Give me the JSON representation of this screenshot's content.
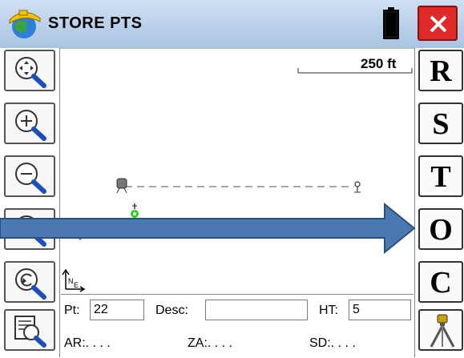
{
  "header": {
    "title": "STORE PTS"
  },
  "map": {
    "scale_label": "250 ft"
  },
  "right_toolbar": {
    "buttons": [
      "R",
      "S",
      "T",
      "O",
      "C"
    ]
  },
  "form": {
    "pt_label": "Pt:",
    "pt_value": "22",
    "desc_label": "Desc:",
    "desc_value": "",
    "ht_label": "HT:",
    "ht_value": "5",
    "ar_label": "AR:. . . .",
    "za_label": "ZA:. . . .",
    "sd_label": "SD:. . . ."
  },
  "colors": {
    "titlebar": "#b9d0ea",
    "close": "#e02a2a",
    "arrow": "#4a78b0",
    "prism_green": "#33cc22"
  }
}
